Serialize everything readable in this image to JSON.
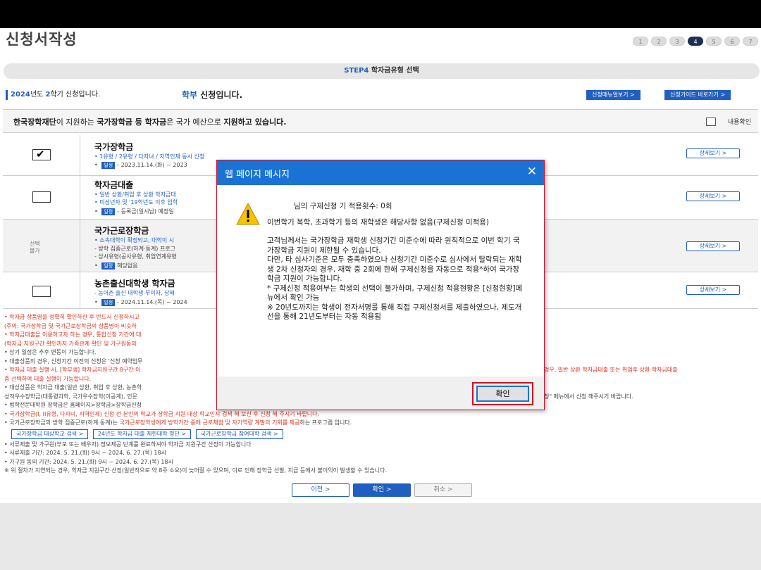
{
  "page": {
    "title": "신청서작성",
    "steps": [
      "1",
      "2",
      "3",
      "4",
      "5",
      "6",
      "7"
    ],
    "active_step": 4
  },
  "step_bar": {
    "step": "STEP4",
    "label": "학자금유형 선택"
  },
  "semester": {
    "year": "2024",
    "year_suffix": "년도 ",
    "term": "2",
    "term_suffix": "학기 신청입니다."
  },
  "univ": {
    "level": "학부",
    "suffix": " 신청입니다."
  },
  "top_buttons": {
    "manual": "신청매뉴얼보기 >",
    "guide": "신청가이드 바로가기 >"
  },
  "notice": {
    "org": "한국장학재단",
    "t1": "이 지원하는 ",
    "b1": "국가장학금 등 학자금",
    "t2": "은 국가 예산으로 ",
    "b2": "지원하고 있습니다.",
    "confirm": "내용확인"
  },
  "rows": [
    {
      "title": "국가장학금",
      "line1": "• 1유형 / 2유형 / 다자녀 / 지역인재 동시 신청",
      "tag": "일정",
      "line2": "- 2023.11.14.(화) ~ 2023",
      "detail": "상세보기 >"
    },
    {
      "title": "학자금대출",
      "line1": "• 일반 상환/취업 후 상환 학자금대",
      "line1b": "• 미성년자 및 '19학년도 이후 입학",
      "tag": "일정",
      "line2": "- 등록금(일시납) 예정일",
      "detail": "상세보기 >"
    },
    {
      "title": "국가근로장학금",
      "disabled": "선택\n불가",
      "line1": "• 소속대학이 확정되고, 대학이 시",
      "line1b": "- 방학 집중근로(하계·동계) 프로그",
      "line1c": "- 상시유형(공사유형, 취업연계유형",
      "tag": "일정",
      "line2": "해당없음",
      "detail": "상세보기 >"
    },
    {
      "title": "농촌출신대학생 학자금",
      "line1": "- 농어촌 출신 대학생 무이자, 당해",
      "tag": "일정",
      "line2": "- 2024.11.14.(목) ~ 2024",
      "detail": "상세보기 >"
    }
  ],
  "notes": [
    "• 학자금 상품명을 정확히 확인하신 후 반드시 신청하시고",
    "(주의: 국가장학금 및 국가근로장학금의 상품명이 비슷하",
    "• 학자금대출을 이용하고자 하는 경우, 통합신청 기간에 대",
    "(학자금 지원구간 확인까지 가족관계 확인 및 가구원동의",
    "• 상기 일정은 추후 변동이 가능합니다.",
    "• 대출상품의 경우, 신청기간 이전의 신청은 '신청 예약업무",
    "• 학자금 대출 실행 시, [학부생] 학자금지원구간 8구간 이",
    "경우, 일반 상환 학자금대출 또는 취업후 상환 학자금대출",
    "중 선택하여 대출 실행이 가능합니다.",
    "• 대상상품은 학자금 대출(일반 상환, 취업 후 상환, 농촌학",
    "성적우수장학금(대통령과학, 국가우수장학(이공계), 인문",
    "청\" 메뉴에서 신청 해주시기 바랍니다.",
    "• 법학전문대학원 장학금은 홈페이지>장학금>장학금신청",
    "• 국가장학금(I, II유형, 다자녀, 지역인재) 신청 전 본인의 학교가 장학금 지원 대상 학교인지 검색 해 보신 후 신청 해 주시기 바랍니다.",
    "• 국가근로장학금의 방학 집중근로(하계·동계)는 ",
    "국가근로장학생에게 방학기간 중에 근로체험 및 자기역량 계발의 기회를 제공",
    "하는 프로그램 입니다.",
    "• 서류제출 및 가구원(부모 또는 배우자) 정보제공 단계를 완료하셔야 학자금 지원구간 산정이 가능합니다",
    "• 서류제출 기간: 2024. 5. 21.(화) 9시 ~ 2024. 6. 27.(목) 18시",
    "• 가구원 동의 기간: 2024. 5. 21.(화) 9시 ~ 2024. 6. 27.(목) 18시",
    "※ 위 절차가 지연되는 경우, 학자금 지원구간 산정(일반적으로 약 8주 소요)이 늦어질 수 있으며, 이로 인해 장학금 선발, 지급 등에서 불이익이 발생할 수 있습니다."
  ],
  "link_buttons": [
    "국가장학금 대상학교 검색 >",
    "24년도 학자금 대출 제한대학 명단 >",
    "국가근로장학금 참여대학 검색 >"
  ],
  "bottom_buttons": {
    "prev": "이전  >",
    "ok": "확인  >",
    "cancel": "취소  >"
  },
  "dialog": {
    "title": "웹 페이지 메시지",
    "close": "✕",
    "p1": "님의 구제신청 기 적용횟수: 0회",
    "p2": "이번학기 복학, 초과학기 등의 재학생은 해당사항 없음(구제신청 미적용)",
    "p3": "고객님께서는              국가장학금 재학생 신청기간 미준수에 따라 원칙적으로 이번 학기 국가장학금 지원이 제한될 수 있습니다.",
    "p4": "다만, 타 심사기준은 모두 충족하였으나 신청기간 미준수로 심사에서 탈락되는 재학생 2차 신청자의 경우, 재학 중 2회에 한해 구제신청을 자동으로 적용*하여 국가장학금 지원이 가능합니다.",
    "p5": "* 구제신청 적용여부는 학생의 선택이 불가하며, 구제신청 적용현황은 [신청현황]메뉴에서 확인 가능",
    "p6": "※ 20년도까지는 학생이 전자서명를 통해 직접 구제신청서를 제출하였으나, 제도개선을 통해 21년도부터는 자동 적용됨",
    "ok": "확인"
  },
  "colors": {
    "accent": "#1f5fbf",
    "dialog_title": "#1a73d4",
    "highlight_red": "#d01020"
  }
}
